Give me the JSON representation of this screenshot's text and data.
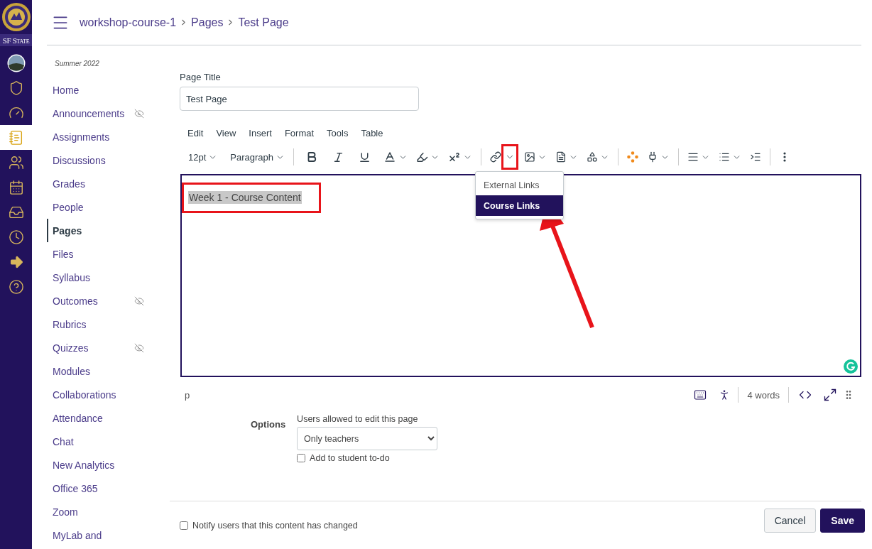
{
  "global_nav": {
    "logo_text": "SF State",
    "items": [
      {
        "kind": "account",
        "selected": false
      },
      {
        "kind": "admin",
        "selected": false
      },
      {
        "kind": "dashboard",
        "selected": false
      },
      {
        "kind": "courses",
        "selected": true
      },
      {
        "kind": "groups",
        "selected": false
      },
      {
        "kind": "calendar",
        "selected": false
      },
      {
        "kind": "inbox",
        "selected": false
      },
      {
        "kind": "history",
        "selected": false
      },
      {
        "kind": "commons",
        "selected": false
      },
      {
        "kind": "help",
        "selected": false
      }
    ]
  },
  "breadcrumbs": [
    "workshop-course-1",
    "Pages",
    "Test Page"
  ],
  "course_nav": {
    "term": "Summer 2022",
    "items": [
      {
        "label": "Home",
        "selected": false,
        "hidden": false
      },
      {
        "label": "Announcements",
        "selected": false,
        "hidden": true
      },
      {
        "label": "Assignments",
        "selected": false,
        "hidden": false
      },
      {
        "label": "Discussions",
        "selected": false,
        "hidden": false
      },
      {
        "label": "Grades",
        "selected": false,
        "hidden": false
      },
      {
        "label": "People",
        "selected": false,
        "hidden": false
      },
      {
        "label": "Pages",
        "selected": true,
        "hidden": false
      },
      {
        "label": "Files",
        "selected": false,
        "hidden": false
      },
      {
        "label": "Syllabus",
        "selected": false,
        "hidden": false
      },
      {
        "label": "Outcomes",
        "selected": false,
        "hidden": true
      },
      {
        "label": "Rubrics",
        "selected": false,
        "hidden": false
      },
      {
        "label": "Quizzes",
        "selected": false,
        "hidden": true
      },
      {
        "label": "Modules",
        "selected": false,
        "hidden": false
      },
      {
        "label": "Collaborations",
        "selected": false,
        "hidden": false
      },
      {
        "label": "Attendance",
        "selected": false,
        "hidden": false
      },
      {
        "label": "Chat",
        "selected": false,
        "hidden": false
      },
      {
        "label": "New Analytics",
        "selected": false,
        "hidden": false
      },
      {
        "label": "Office 365",
        "selected": false,
        "hidden": false
      },
      {
        "label": "Zoom",
        "selected": false,
        "hidden": false
      },
      {
        "label": "MyLab and",
        "selected": false,
        "hidden": false
      }
    ]
  },
  "page_title": {
    "label": "Page Title",
    "value": "Test Page"
  },
  "menu_bar": [
    "Edit",
    "View",
    "Insert",
    "Format",
    "Tools",
    "Table"
  ],
  "toolbar": {
    "font_size": "12pt",
    "block_format": "Paragraph"
  },
  "link_menu": {
    "items": [
      {
        "label": "External Links",
        "selected": false
      },
      {
        "label": "Course Links",
        "selected": true
      }
    ]
  },
  "editor": {
    "text": "Week 1 - Course Content",
    "selected": true
  },
  "status_bar": {
    "element_path": "p",
    "word_count": "4 words"
  },
  "options": {
    "label": "Options",
    "editors_label": "Users allowed to edit this page",
    "editors_value": "Only teachers",
    "todo": {
      "label": "Add to student to-do",
      "checked": false
    }
  },
  "footer": {
    "notify": {
      "label": "Notify users that this content has changed",
      "checked": false
    },
    "buttons": [
      {
        "label": "Cancel",
        "kind": "secondary"
      },
      {
        "label": "Save",
        "kind": "primary"
      }
    ]
  }
}
